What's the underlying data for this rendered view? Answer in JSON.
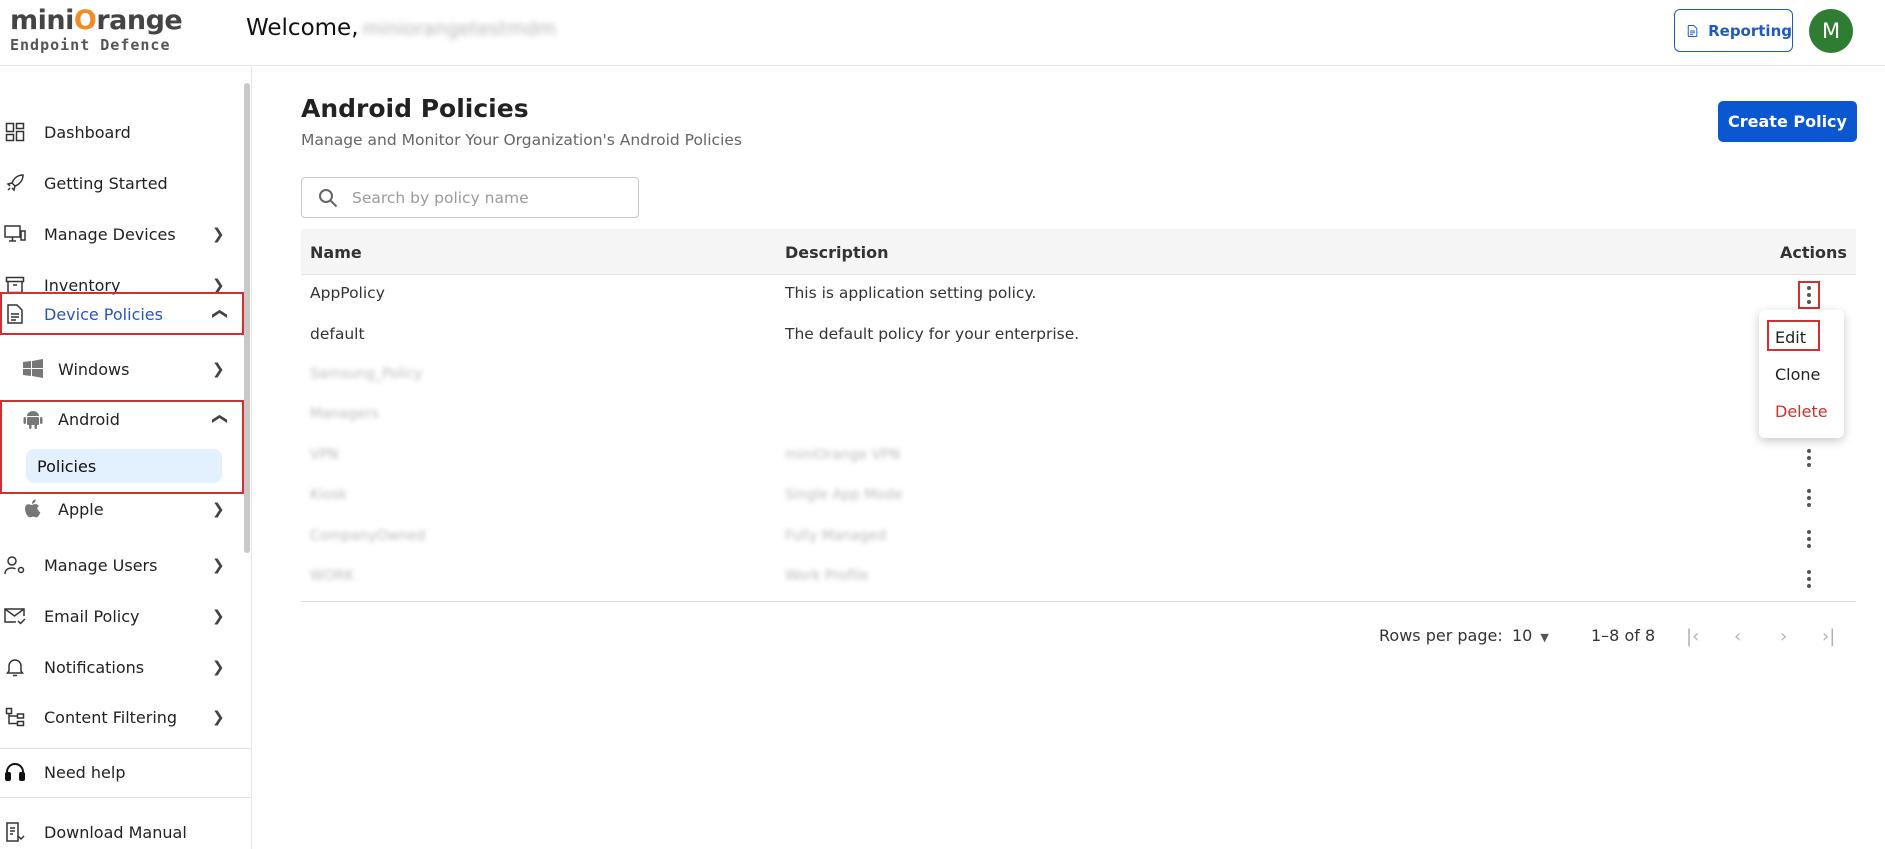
{
  "header": {
    "logo_line1_a": "mini",
    "logo_line1_b": "O",
    "logo_line1_c": "range",
    "logo_line2": "Endpoint Defence",
    "welcome": "Welcome,",
    "username": "miniorangetestmdm",
    "reporting_label": "Reporting",
    "avatar_letter": "M"
  },
  "sidebar": {
    "items": [
      {
        "label": "Dashboard",
        "icon": "dashboard-icon"
      },
      {
        "label": "Getting Started",
        "icon": "rocket-icon"
      },
      {
        "label": "Manage Devices",
        "icon": "monitor-icon"
      },
      {
        "label": "Inventory",
        "icon": "archive-icon"
      },
      {
        "label": "Device Policies",
        "icon": "document-icon"
      },
      {
        "label": "Windows",
        "icon": "windows-icon"
      },
      {
        "label": "Android",
        "icon": "android-icon"
      },
      {
        "label": "Policies"
      },
      {
        "label": "Apple",
        "icon": "apple-icon"
      },
      {
        "label": "Manage Users",
        "icon": "user-settings-icon"
      },
      {
        "label": "Email Policy",
        "icon": "mail-check-icon"
      },
      {
        "label": "Notifications",
        "icon": "bell-icon"
      },
      {
        "label": "Content Filtering",
        "icon": "tree-icon"
      },
      {
        "label": "Need help",
        "icon": "headset-icon"
      },
      {
        "label": "Download Manual",
        "icon": "manual-icon"
      }
    ]
  },
  "main": {
    "title": "Android Policies",
    "subtitle": "Manage and Monitor Your Organization's Android Policies",
    "create_button": "Create Policy",
    "search_placeholder": "Search by policy name",
    "columns": {
      "name": "Name",
      "description": "Description",
      "actions": "Actions"
    },
    "rows": [
      {
        "name": "AppPolicy",
        "description": "This is application setting policy."
      },
      {
        "name": "default",
        "description": "The default policy for your enterprise."
      },
      {
        "name": "Samsung_Policy",
        "description": ""
      },
      {
        "name": "Managers",
        "description": ""
      },
      {
        "name": "VPN",
        "description": "miniOrange VPN"
      },
      {
        "name": "Kiosk",
        "description": "Single App Mode"
      },
      {
        "name": "CompanyOwned",
        "description": "Fully Managed"
      },
      {
        "name": "WORK",
        "description": "Work Profile"
      }
    ],
    "action_menu": [
      "Edit",
      "Clone",
      "Delete"
    ],
    "pagination": {
      "rows_per_page_label": "Rows per page:",
      "rows_per_page": "10",
      "range": "1–8 of 8"
    }
  },
  "colors": {
    "primary": "#0a57d0",
    "highlight": "#d32f2f",
    "avatar": "#2e7d32",
    "selected_bg": "#e3f0fd"
  }
}
